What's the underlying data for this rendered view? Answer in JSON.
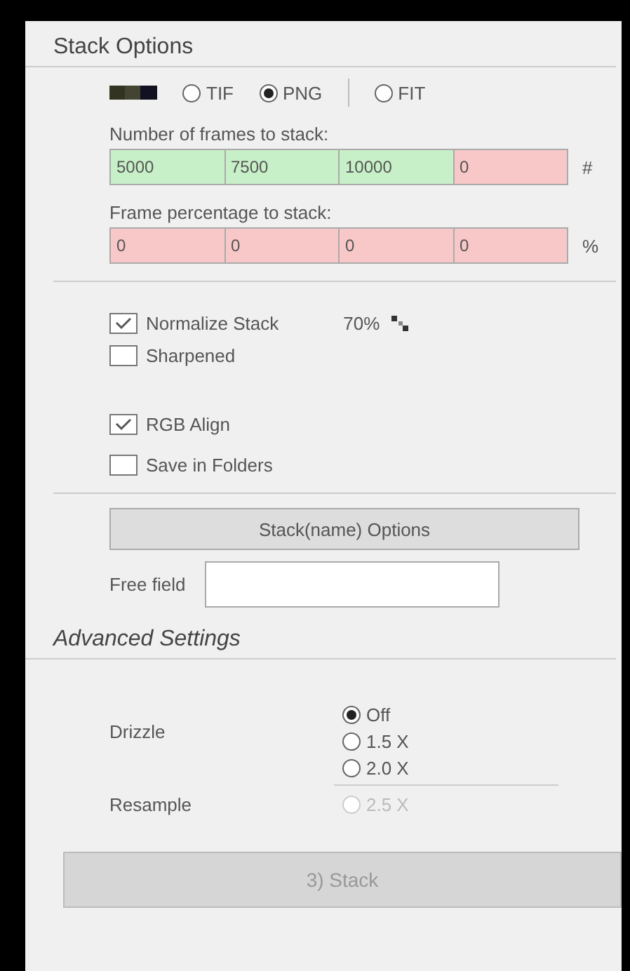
{
  "stack_options": {
    "title": "Stack Options",
    "formats": [
      {
        "label": "TIF",
        "selected": false
      },
      {
        "label": "PNG",
        "selected": true
      },
      {
        "label": "FIT",
        "selected": false
      }
    ],
    "frames_label": "Number of frames to stack:",
    "frames": [
      {
        "value": "5000",
        "valid": true
      },
      {
        "value": "7500",
        "valid": true
      },
      {
        "value": "10000",
        "valid": true
      },
      {
        "value": "0",
        "valid": false
      }
    ],
    "frames_unit": "#",
    "percent_label": "Frame percentage to stack:",
    "percents": [
      {
        "value": "0",
        "valid": false
      },
      {
        "value": "0",
        "valid": false
      },
      {
        "value": "0",
        "valid": false
      },
      {
        "value": "0",
        "valid": false
      }
    ],
    "percent_unit": "%",
    "normalize": {
      "label": "Normalize Stack",
      "checked": true,
      "reading": "70%"
    },
    "sharpened": {
      "label": "Sharpened",
      "checked": false
    },
    "rgb_align": {
      "label": "RGB Align",
      "checked": true
    },
    "save_in_folders": {
      "label": "Save in Folders",
      "checked": false
    },
    "options_button": "Stack(name) Options",
    "free_field": {
      "label": "Free field"
    }
  },
  "advanced": {
    "title": "Advanced Settings",
    "drizzle_label": "Drizzle",
    "drizzle": [
      {
        "label": "Off",
        "selected": true
      },
      {
        "label": "1.5 X",
        "selected": false
      },
      {
        "label": "2.0 X",
        "selected": false
      }
    ],
    "resample_label": "Resample",
    "resample": {
      "label": "2.5 X",
      "selected": false,
      "disabled": true
    }
  },
  "stack_button": "3) Stack"
}
